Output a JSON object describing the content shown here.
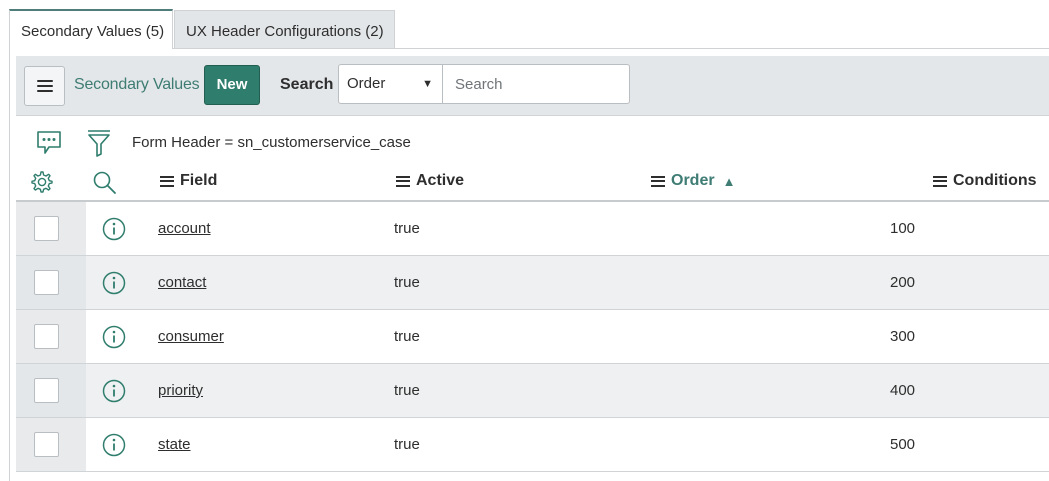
{
  "tabs": [
    {
      "label": "Secondary Values (5)",
      "active": true
    },
    {
      "label": "UX Header Configurations (2)",
      "active": false
    }
  ],
  "toolbar": {
    "menu_icon": "hamburger-icon",
    "title": "Secondary Values",
    "new_label": "New",
    "search_label": "Search",
    "search_field_selected": "Order",
    "search_placeholder": "Search"
  },
  "filter": {
    "breadcrumb": "Form Header = sn_customerservice_case"
  },
  "columns": {
    "field": "Field",
    "active": "Active",
    "order": "Order",
    "conditions": "Conditions"
  },
  "rows": [
    {
      "field": "account",
      "active": "true",
      "order": "100"
    },
    {
      "field": "contact",
      "active": "true",
      "order": "200"
    },
    {
      "field": "consumer",
      "active": "true",
      "order": "300"
    },
    {
      "field": "priority",
      "active": "true",
      "order": "400"
    },
    {
      "field": "state",
      "active": "true",
      "order": "500"
    }
  ],
  "colors": {
    "accent": "#3e7c74",
    "new_button": "#2f7d6d",
    "toolbar_bg": "#e4e7e9",
    "stripe": "#eef0f1"
  }
}
